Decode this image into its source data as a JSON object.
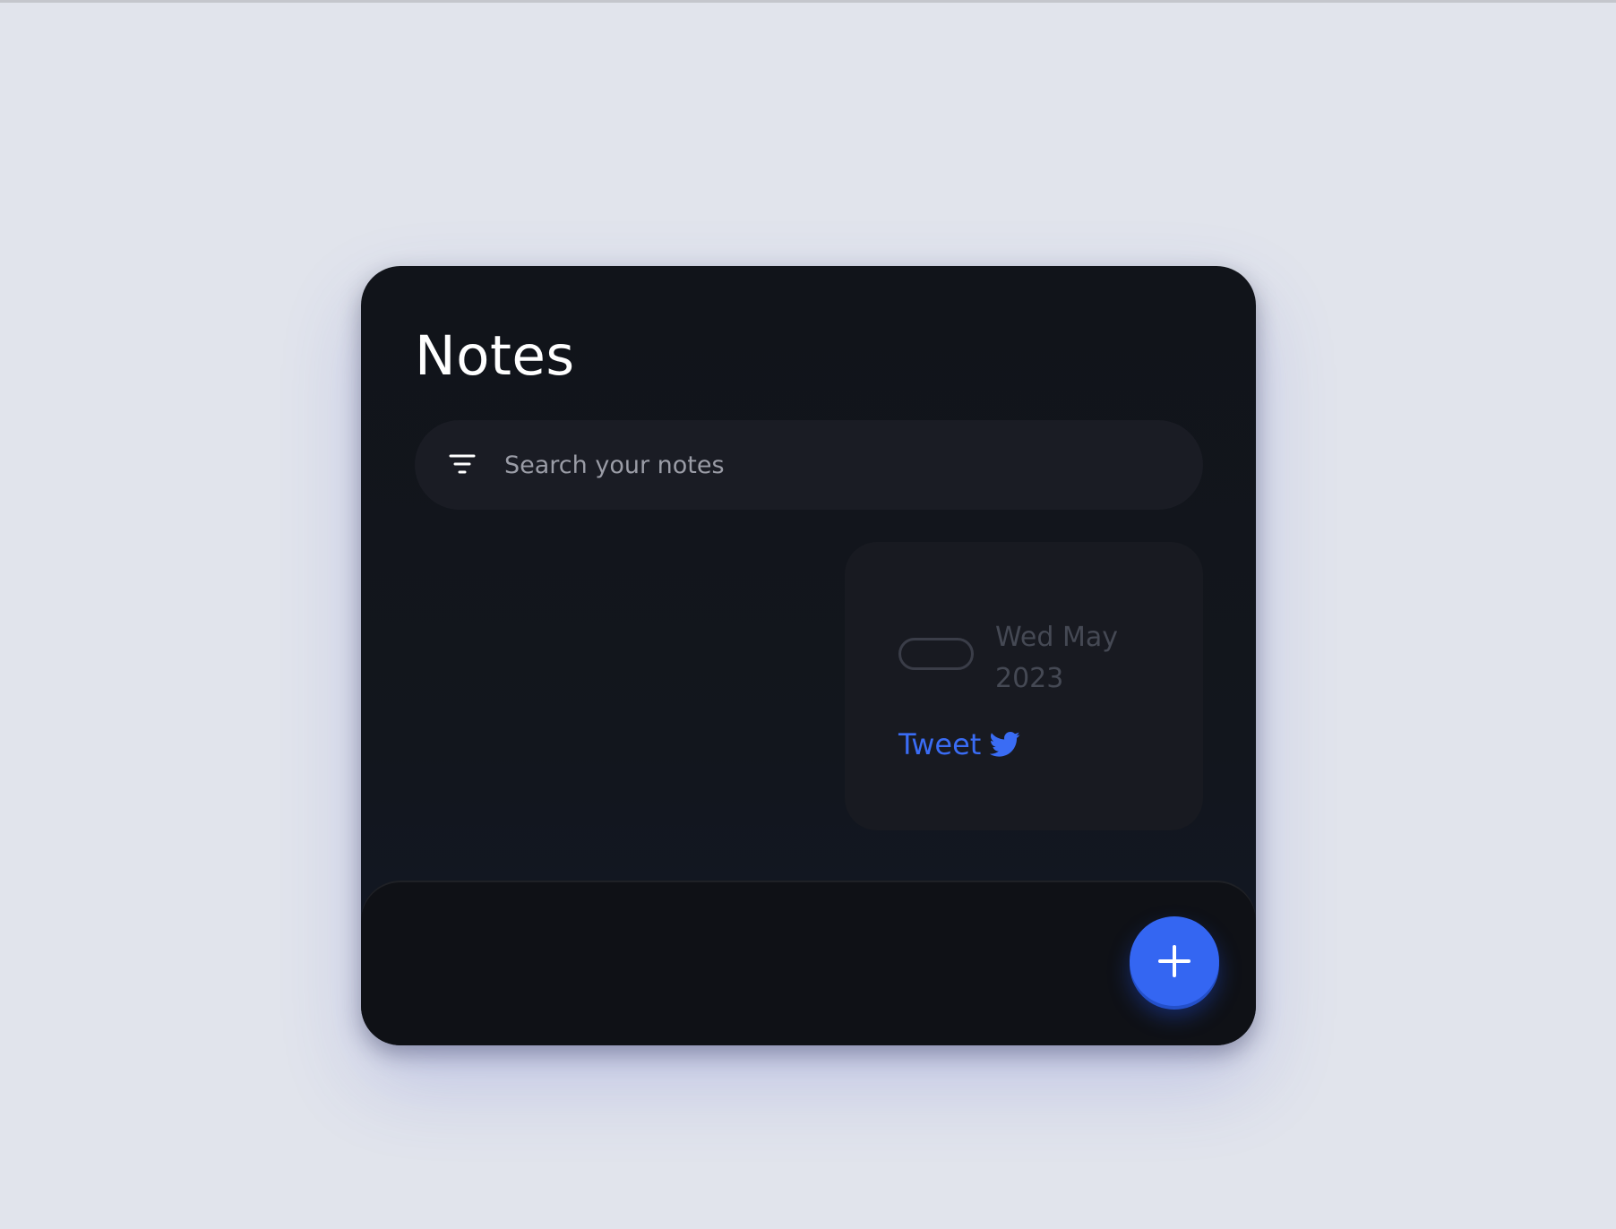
{
  "app": {
    "title": "Notes"
  },
  "search": {
    "placeholder": "Search your notes",
    "filter_icon": "filter-icon"
  },
  "notes": [
    {
      "date": "Wed May 2023",
      "tag_shape": "empty-pill",
      "action_label": "Tweet",
      "action_icon": "twitter-bird-icon"
    }
  ],
  "fab": {
    "icon": "plus-icon"
  },
  "colors": {
    "page_background": "#e1e4ec",
    "card_background": "#11141a",
    "search_background": "#1a1c24",
    "note_background": "#181a21",
    "accent": "#3466f2",
    "link": "#3a6cf4",
    "muted_text": "#454954"
  }
}
